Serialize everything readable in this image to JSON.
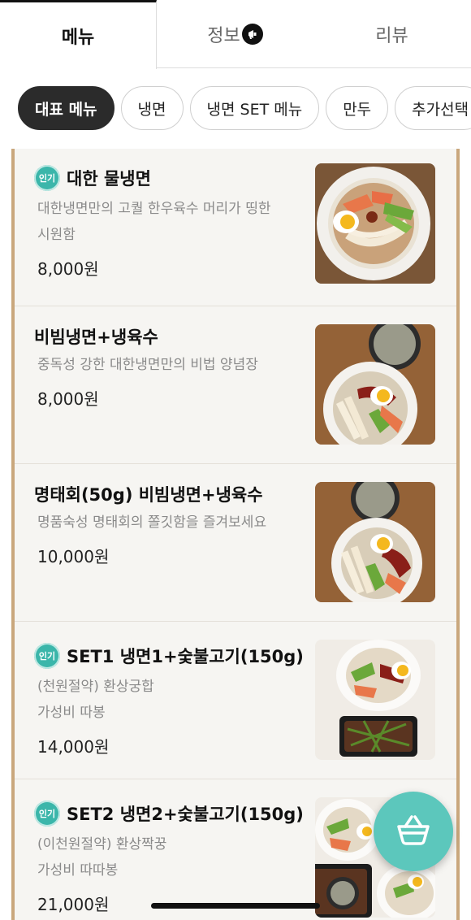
{
  "tabs": [
    {
      "label": "메뉴",
      "active": true
    },
    {
      "label": "정보",
      "icon": "megaphone-icon"
    },
    {
      "label": "리뷰"
    }
  ],
  "categories": [
    {
      "label": "대표 메뉴",
      "active": true
    },
    {
      "label": "냉면"
    },
    {
      "label": "냉면 SET 메뉴"
    },
    {
      "label": "만두"
    },
    {
      "label": "추가선택"
    }
  ],
  "popular_badge": "인기",
  "menu_items": [
    {
      "name": "대한 물냉면",
      "popular": true,
      "desc_lines": [
        "대한냉면만의 고퀄 한우육수 머리가 띵한",
        "시원함"
      ],
      "price": "8,000원",
      "image": "mul-naengmyeon-bowl"
    },
    {
      "name": "비빔냉면+냉육수",
      "popular": false,
      "desc_lines": [
        "중독성 강한 대한냉면만의 비법 양념장"
      ],
      "price": "8,000원",
      "image": "bibim-naengmyeon-with-broth"
    },
    {
      "name": "명태회(50g) 비빔냉면+냉육수",
      "popular": false,
      "desc_lines": [
        "명품숙성 명태회의 쫄깃함을 즐겨보세요"
      ],
      "price": "10,000원",
      "image": "myeongtae-bibim-naengmyeon"
    },
    {
      "name": "SET1 냉면1+숯불고기(150g)",
      "popular": true,
      "desc_lines": [
        "(천원절약) 환상궁합",
        "가성비 따봉"
      ],
      "price": "14,000원",
      "image": "set1-naengmyeon-bulgogi"
    },
    {
      "name": "SET2 냉면2+숯불고기(150g)",
      "popular": true,
      "desc_lines": [
        "(이천원절약) 환상짝꿍",
        "가성비 따따봉"
      ],
      "price": "21,000원",
      "image": "set2-naengmyeon-bulgogi"
    }
  ],
  "colors": {
    "accent": "#5cc7bc",
    "badge": "#3bb6aa",
    "frame": "#c9a77d",
    "chip_active": "#2b2b2b"
  }
}
